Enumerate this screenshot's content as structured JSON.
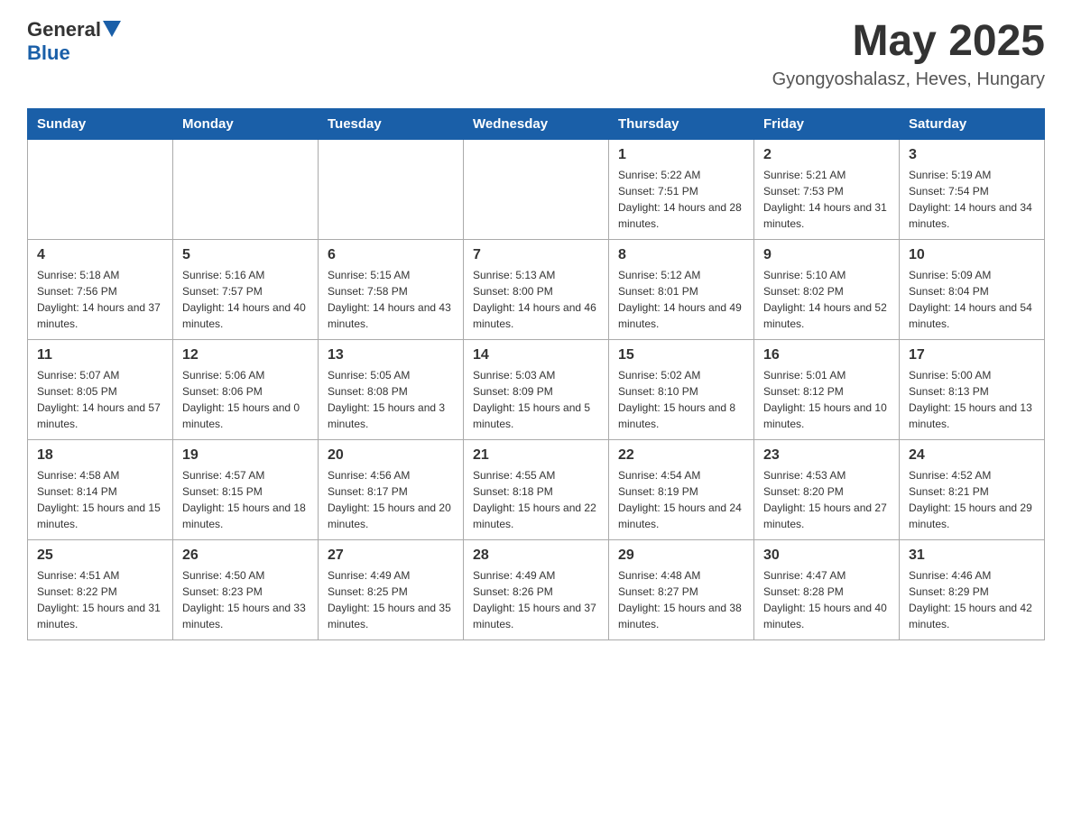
{
  "logo": {
    "text_general": "General",
    "text_blue": "Blue",
    "arrow": "▲"
  },
  "title": {
    "month_year": "May 2025",
    "location": "Gyongyoshalasz, Heves, Hungary"
  },
  "weekdays": [
    "Sunday",
    "Monday",
    "Tuesday",
    "Wednesday",
    "Thursday",
    "Friday",
    "Saturday"
  ],
  "weeks": [
    [
      {
        "day": "",
        "info": ""
      },
      {
        "day": "",
        "info": ""
      },
      {
        "day": "",
        "info": ""
      },
      {
        "day": "",
        "info": ""
      },
      {
        "day": "1",
        "info": "Sunrise: 5:22 AM\nSunset: 7:51 PM\nDaylight: 14 hours and 28 minutes."
      },
      {
        "day": "2",
        "info": "Sunrise: 5:21 AM\nSunset: 7:53 PM\nDaylight: 14 hours and 31 minutes."
      },
      {
        "day": "3",
        "info": "Sunrise: 5:19 AM\nSunset: 7:54 PM\nDaylight: 14 hours and 34 minutes."
      }
    ],
    [
      {
        "day": "4",
        "info": "Sunrise: 5:18 AM\nSunset: 7:56 PM\nDaylight: 14 hours and 37 minutes."
      },
      {
        "day": "5",
        "info": "Sunrise: 5:16 AM\nSunset: 7:57 PM\nDaylight: 14 hours and 40 minutes."
      },
      {
        "day": "6",
        "info": "Sunrise: 5:15 AM\nSunset: 7:58 PM\nDaylight: 14 hours and 43 minutes."
      },
      {
        "day": "7",
        "info": "Sunrise: 5:13 AM\nSunset: 8:00 PM\nDaylight: 14 hours and 46 minutes."
      },
      {
        "day": "8",
        "info": "Sunrise: 5:12 AM\nSunset: 8:01 PM\nDaylight: 14 hours and 49 minutes."
      },
      {
        "day": "9",
        "info": "Sunrise: 5:10 AM\nSunset: 8:02 PM\nDaylight: 14 hours and 52 minutes."
      },
      {
        "day": "10",
        "info": "Sunrise: 5:09 AM\nSunset: 8:04 PM\nDaylight: 14 hours and 54 minutes."
      }
    ],
    [
      {
        "day": "11",
        "info": "Sunrise: 5:07 AM\nSunset: 8:05 PM\nDaylight: 14 hours and 57 minutes."
      },
      {
        "day": "12",
        "info": "Sunrise: 5:06 AM\nSunset: 8:06 PM\nDaylight: 15 hours and 0 minutes."
      },
      {
        "day": "13",
        "info": "Sunrise: 5:05 AM\nSunset: 8:08 PM\nDaylight: 15 hours and 3 minutes."
      },
      {
        "day": "14",
        "info": "Sunrise: 5:03 AM\nSunset: 8:09 PM\nDaylight: 15 hours and 5 minutes."
      },
      {
        "day": "15",
        "info": "Sunrise: 5:02 AM\nSunset: 8:10 PM\nDaylight: 15 hours and 8 minutes."
      },
      {
        "day": "16",
        "info": "Sunrise: 5:01 AM\nSunset: 8:12 PM\nDaylight: 15 hours and 10 minutes."
      },
      {
        "day": "17",
        "info": "Sunrise: 5:00 AM\nSunset: 8:13 PM\nDaylight: 15 hours and 13 minutes."
      }
    ],
    [
      {
        "day": "18",
        "info": "Sunrise: 4:58 AM\nSunset: 8:14 PM\nDaylight: 15 hours and 15 minutes."
      },
      {
        "day": "19",
        "info": "Sunrise: 4:57 AM\nSunset: 8:15 PM\nDaylight: 15 hours and 18 minutes."
      },
      {
        "day": "20",
        "info": "Sunrise: 4:56 AM\nSunset: 8:17 PM\nDaylight: 15 hours and 20 minutes."
      },
      {
        "day": "21",
        "info": "Sunrise: 4:55 AM\nSunset: 8:18 PM\nDaylight: 15 hours and 22 minutes."
      },
      {
        "day": "22",
        "info": "Sunrise: 4:54 AM\nSunset: 8:19 PM\nDaylight: 15 hours and 24 minutes."
      },
      {
        "day": "23",
        "info": "Sunrise: 4:53 AM\nSunset: 8:20 PM\nDaylight: 15 hours and 27 minutes."
      },
      {
        "day": "24",
        "info": "Sunrise: 4:52 AM\nSunset: 8:21 PM\nDaylight: 15 hours and 29 minutes."
      }
    ],
    [
      {
        "day": "25",
        "info": "Sunrise: 4:51 AM\nSunset: 8:22 PM\nDaylight: 15 hours and 31 minutes."
      },
      {
        "day": "26",
        "info": "Sunrise: 4:50 AM\nSunset: 8:23 PM\nDaylight: 15 hours and 33 minutes."
      },
      {
        "day": "27",
        "info": "Sunrise: 4:49 AM\nSunset: 8:25 PM\nDaylight: 15 hours and 35 minutes."
      },
      {
        "day": "28",
        "info": "Sunrise: 4:49 AM\nSunset: 8:26 PM\nDaylight: 15 hours and 37 minutes."
      },
      {
        "day": "29",
        "info": "Sunrise: 4:48 AM\nSunset: 8:27 PM\nDaylight: 15 hours and 38 minutes."
      },
      {
        "day": "30",
        "info": "Sunrise: 4:47 AM\nSunset: 8:28 PM\nDaylight: 15 hours and 40 minutes."
      },
      {
        "day": "31",
        "info": "Sunrise: 4:46 AM\nSunset: 8:29 PM\nDaylight: 15 hours and 42 minutes."
      }
    ]
  ]
}
